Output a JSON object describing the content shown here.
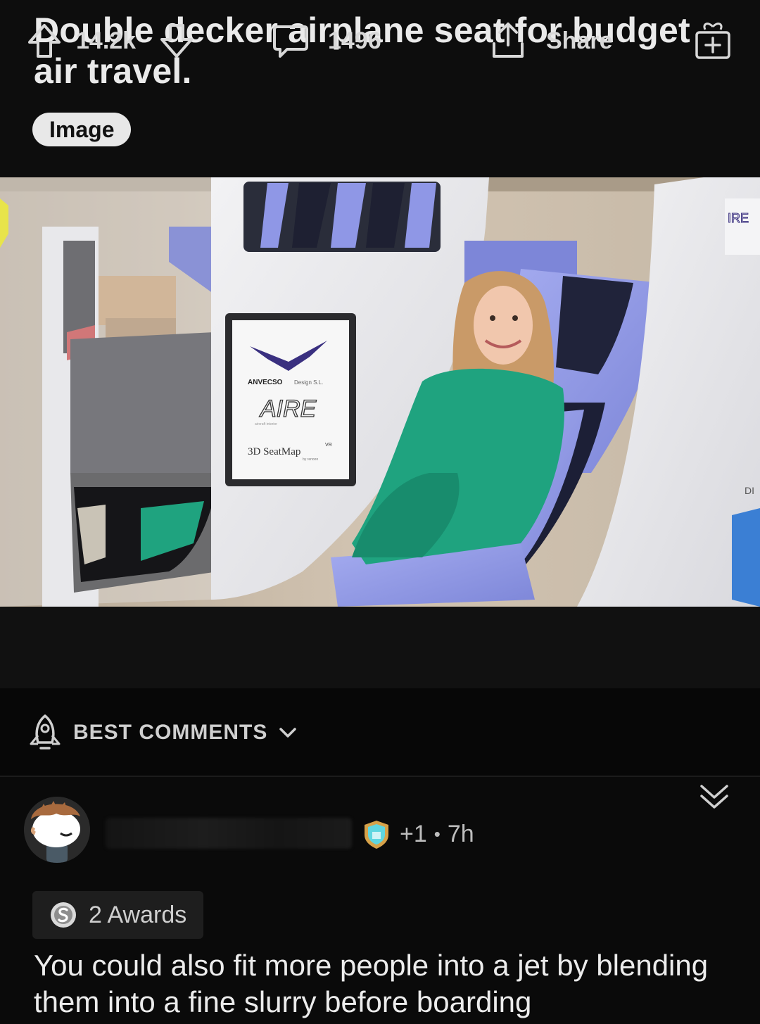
{
  "post": {
    "title": "Double decker airplane seat for budget air travel.",
    "flair": "Image",
    "image": {
      "sign": {
        "brand": "ANVECSO",
        "brand_suffix": "Design S.L.",
        "product": "AIRE",
        "product_subtitle": "aircraft interior",
        "seatmap": "3D SeatMap",
        "seatmap_sup": "VR",
        "seatmap_by": "by renoon"
      },
      "edge_text_top": "IRE",
      "edge_text_mid": "DI"
    }
  },
  "actions": {
    "upvote_icon": "arrow-up-icon",
    "score": "14.2k",
    "downvote_icon": "arrow-down-icon",
    "comment_icon": "comment-bubble-icon",
    "comment_count": "1496",
    "share_icon": "share-icon",
    "share_label": "Share",
    "award_icon": "gift-icon"
  },
  "comments": {
    "sort_icon": "rocket-icon",
    "sort_label": "BEST COMMENTS",
    "sort_chevron_icon": "chevron-down-icon"
  },
  "comment": {
    "avatar_icon": "snoo-avatar-icon",
    "badge_icon": "shield-badge-icon",
    "score_change": "+1",
    "separator": "•",
    "age": "7h",
    "collapse_icon": "double-chevron-down-icon",
    "awards_icon": "silver-coin-icon",
    "awards_label": "2 Awards",
    "body": "You could also fit more people into a jet by blending them into a fine slurry before boarding"
  },
  "colors": {
    "background": "#0b0b0b",
    "action_bar": "#111111",
    "text": "#e6e6e6",
    "muted": "#bdbdbd",
    "flair_bg": "#e8e8e8",
    "seat_blue": "#8f97e6",
    "jacket_green": "#1fa37f"
  }
}
